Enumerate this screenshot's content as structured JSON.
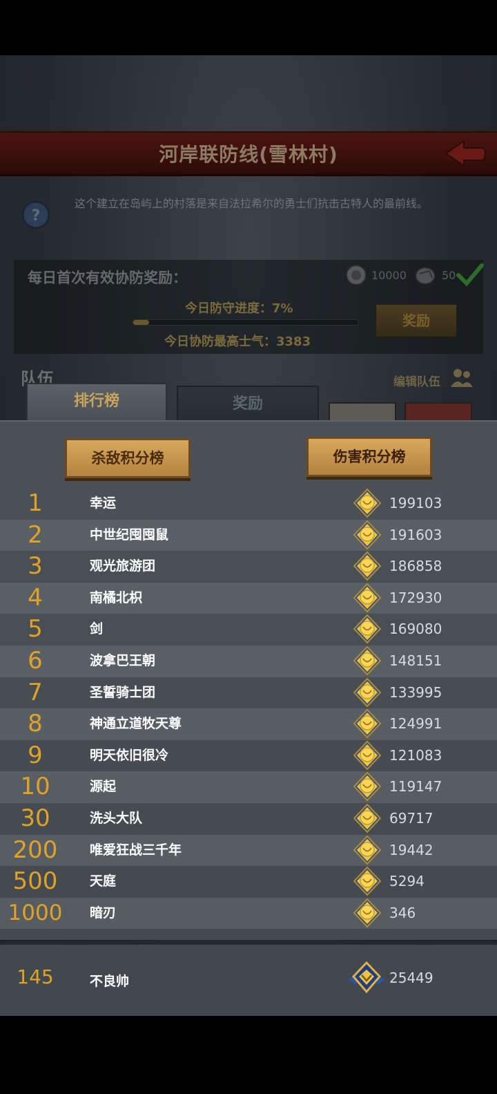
{
  "header": {
    "title": "河岸联防线(雪林村)"
  },
  "intro": {
    "description": "这个建立在岛屿上的村落是来自法拉希尔的勇士们抗击古特人的最前线。"
  },
  "daily_reward": {
    "label": "每日首次有效协防奖励：",
    "currency_1": "10000",
    "currency_2": "50",
    "progress_label": "今日防守进度：7%",
    "progress_value": 0.07,
    "morale_label": "今日协防最高士气：3383",
    "claim_button": "奖励"
  },
  "team": {
    "label": "队伍",
    "edit_label": "编辑队伍"
  },
  "tabs": [
    {
      "label": "排行榜"
    },
    {
      "label": "奖励"
    }
  ],
  "boards": {
    "kill": "杀敌积分榜",
    "damage": "伤害积分榜"
  },
  "rankings": [
    {
      "rank": "1",
      "name": "幸运",
      "score": "199103"
    },
    {
      "rank": "2",
      "name": "中世纪囤囤鼠",
      "score": "191603"
    },
    {
      "rank": "3",
      "name": "观光旅游团",
      "score": "186858"
    },
    {
      "rank": "4",
      "name": "南橘北枳",
      "score": "172930"
    },
    {
      "rank": "5",
      "name": "剑",
      "score": "169080"
    },
    {
      "rank": "6",
      "name": "波拿巴王朝",
      "score": "148151"
    },
    {
      "rank": "7",
      "name": "圣誓骑士团",
      "score": "133995"
    },
    {
      "rank": "8",
      "name": "神通立道牧天尊",
      "score": "124991"
    },
    {
      "rank": "9",
      "name": "明天依旧很冷",
      "score": "121083"
    },
    {
      "rank": "10",
      "name": "源起",
      "score": "119147"
    },
    {
      "rank": "30",
      "name": "洗头大队",
      "score": "69717"
    },
    {
      "rank": "200",
      "name": "唯爱狂战三千年",
      "score": "19442"
    },
    {
      "rank": "500",
      "name": "天庭",
      "score": "5294"
    },
    {
      "rank": "1000",
      "name": "暗刃",
      "score": "346"
    }
  ],
  "my_rank": {
    "rank": "145",
    "name": "不良帅",
    "score": "25449"
  }
}
